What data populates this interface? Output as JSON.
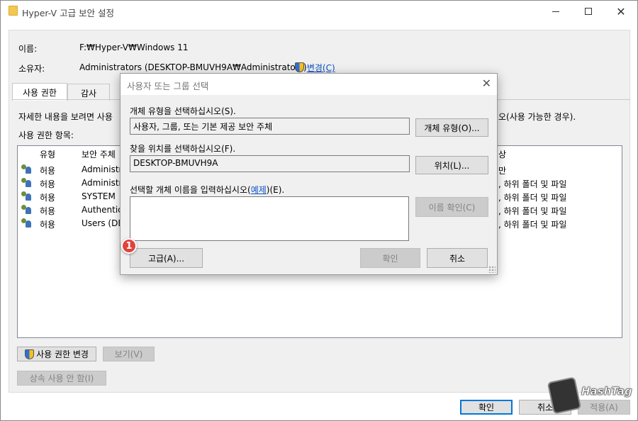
{
  "window": {
    "title": "Hyper-V 고급 보안 설정"
  },
  "main": {
    "name_label": "이름:",
    "name_value": "F:₩Hyper-V₩Windows 11",
    "owner_label": "소유자:",
    "owner_value": "Administrators (DESKTOP-BMUVH9A₩Administrators)",
    "owner_change_link": "변경(C)",
    "tabs": [
      {
        "label": "사용 권한"
      },
      {
        "label": "감사"
      }
    ],
    "info_text_left": "자세한 내용을 보려면 사용",
    "info_text_right": "오(사용 가능한 경우).",
    "entries_label": "사용 권한 항목:",
    "columns": {
      "type": "유형",
      "principal": "보안 주체",
      "applies": "상"
    },
    "rows": [
      {
        "type": "허용",
        "principal": "Administra",
        "applies": "만"
      },
      {
        "type": "허용",
        "principal": "Administra",
        "applies": ", 하위 폴더 및 파일"
      },
      {
        "type": "허용",
        "principal": "SYSTEM",
        "applies": ", 하위 폴더 및 파일"
      },
      {
        "type": "허용",
        "principal": "Authentica",
        "applies": ", 하위 폴더 및 파일"
      },
      {
        "type": "허용",
        "principal": "Users (DES",
        "applies": ", 하위 폴더 및 파일"
      }
    ],
    "btn_change_perms": "사용 권한 변경",
    "btn_view": "보기(V)",
    "btn_disable_inherit": "상속 사용 안 함(I)",
    "btn_ok": "확인",
    "btn_cancel": "취소",
    "btn_apply": "적용(A)"
  },
  "dialog": {
    "title": "사용자 또는 그룹 선택",
    "object_type_label": "개체 유형을 선택하십시오(S).",
    "object_type_value": "사용자, 그룹, 또는 기본 제공 보안 주체",
    "object_type_button": "개체 유형(O)...",
    "location_label": "찾을 위치를 선택하십시오(F).",
    "location_value": "DESKTOP-BMUVH9A",
    "location_button": "위치(L)...",
    "enter_label_pre": "선택할 개체 이름을 입력하십시오(",
    "enter_label_link": "예제",
    "enter_label_post": ")(E).",
    "check_names_button": "이름 확인(C)",
    "advanced_button": "고급(A)...",
    "ok_button": "확인",
    "cancel_button": "취소"
  },
  "annotation": {
    "step": "1"
  },
  "watermark": {
    "text": "HashTag"
  },
  "colors": {
    "link": "#0a50c8",
    "badge": "#e0433e",
    "focus": "#0078d7"
  }
}
